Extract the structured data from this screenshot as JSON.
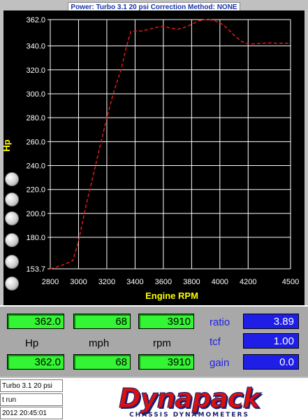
{
  "header": {
    "title": "Power: Turbo 3.1 20 psi   Correction Method: NONE"
  },
  "chart": {
    "ylabel": "Hp",
    "xlabel": "Engine RPM",
    "y_ticks": [
      "362.0",
      "340.0",
      "320.0",
      "300.0",
      "280.0",
      "260.0",
      "240.0",
      "220.0",
      "200.0",
      "180.0",
      "153.7"
    ],
    "x_ticks": [
      "2800",
      "3000",
      "3200",
      "3400",
      "3600",
      "3800",
      "4000",
      "4200",
      "4500"
    ],
    "colors": {
      "background": "#000000",
      "grid": "#ffffff",
      "tick_text": "#ffffff",
      "label_text": "#ffff00",
      "curve": "#e01a1a"
    }
  },
  "chart_data": {
    "type": "line",
    "title": "Power: Turbo 3.1 20 psi   Correction Method: NONE",
    "xlabel": "Engine RPM",
    "ylabel": "Hp",
    "x_ticks": [
      2800,
      3000,
      3200,
      3400,
      3600,
      3800,
      4000,
      4200,
      4500
    ],
    "y_ticks": [
      362.0,
      340.0,
      320.0,
      300.0,
      280.0,
      260.0,
      240.0,
      220.0,
      200.0,
      180.0,
      153.7
    ],
    "xlim": [
      2800,
      4500
    ],
    "ylim": [
      153.7,
      362.0
    ],
    "grid": true,
    "series": [
      {
        "style": "dashed",
        "color": "#e01a1a",
        "x": [
          2800,
          2880,
          2960,
          3000,
          3050,
          3100,
          3150,
          3200,
          3250,
          3300,
          3340,
          3370,
          3400,
          3450,
          3500,
          3550,
          3600,
          3650,
          3700,
          3750,
          3800,
          3850,
          3900,
          3950,
          4000,
          4050,
          4100,
          4150,
          4200,
          4250,
          4300,
          4350,
          4400,
          4450,
          4500
        ],
        "y": [
          153.7,
          156.5,
          160.5,
          177,
          205,
          230,
          255,
          280,
          302,
          320,
          340,
          352,
          352.5,
          352.5,
          354,
          355.5,
          356.2,
          355,
          354,
          355.5,
          358,
          361,
          362,
          361.5,
          359.5,
          355,
          349,
          344,
          341.5,
          341.8,
          342.2,
          342.5,
          342.2,
          342.2,
          342.2
        ]
      }
    ]
  },
  "readout": {
    "top_hp": "362.0",
    "top_mph": "68",
    "top_rpm": "3910",
    "hp_label": "Hp",
    "mph_label": "mph",
    "rpm_label": "rpm",
    "bottom_hp": "362.0",
    "bottom_mph": "68",
    "bottom_rpm": "3910",
    "ratio_label": "ratio",
    "ratio_value": "3.89",
    "tcf_label": "tcf",
    "tcf_value": "1.00",
    "gain_label": "gain",
    "gain_value": "0.0"
  },
  "footer": {
    "run_name": "Turbo 3.1 20 psi",
    "run_type": "t run",
    "timestamp": "2012  20:45:01"
  },
  "logo": {
    "name": "Dynapack",
    "subtitle": "CHASSIS DYNAMOMETERS"
  }
}
